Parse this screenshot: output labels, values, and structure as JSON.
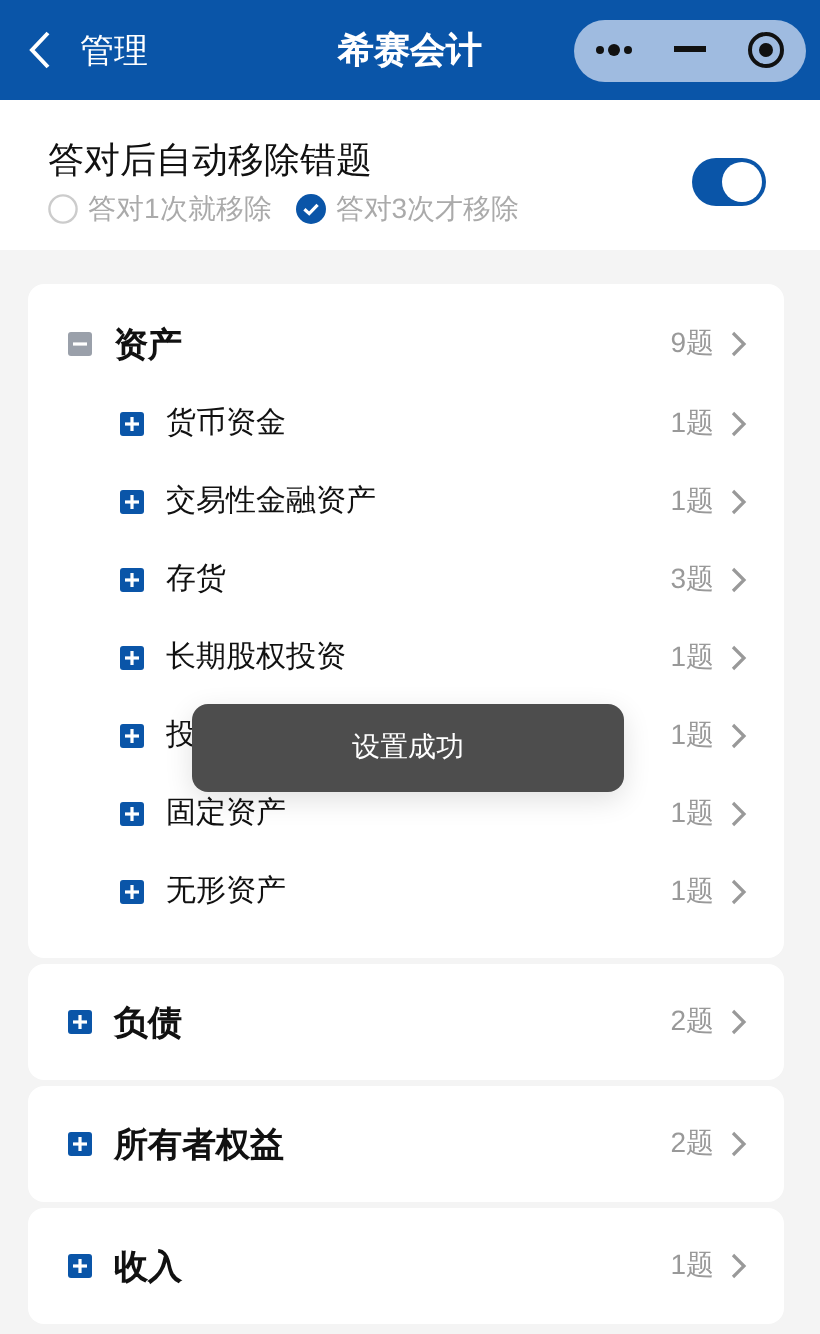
{
  "header": {
    "back_label": "管理",
    "title": "希赛会计"
  },
  "setting": {
    "label": "答对后自动移除错题",
    "on": true,
    "options": [
      {
        "label": "答对1次就移除",
        "selected": false
      },
      {
        "label": "答对3次才移除",
        "selected": true
      }
    ]
  },
  "categories": [
    {
      "name": "资产",
      "count": "9题",
      "expanded": true,
      "children": [
        {
          "name": "货币资金",
          "count": "1题",
          "expanded": false
        },
        {
          "name": "交易性金融资产",
          "count": "1题",
          "expanded": false
        },
        {
          "name": "存货",
          "count": "3题",
          "expanded": false
        },
        {
          "name": "长期股权投资",
          "count": "1题",
          "expanded": false
        },
        {
          "name": "投",
          "count": "1题",
          "expanded": false
        },
        {
          "name": "固定资产",
          "count": "1题",
          "expanded": false
        },
        {
          "name": "无形资产",
          "count": "1题",
          "expanded": false
        }
      ]
    },
    {
      "name": "负债",
      "count": "2题",
      "expanded": false
    },
    {
      "name": "所有者权益",
      "count": "2题",
      "expanded": false
    },
    {
      "name": "收入",
      "count": "1题",
      "expanded": false
    }
  ],
  "toast": {
    "text": "设置成功"
  }
}
